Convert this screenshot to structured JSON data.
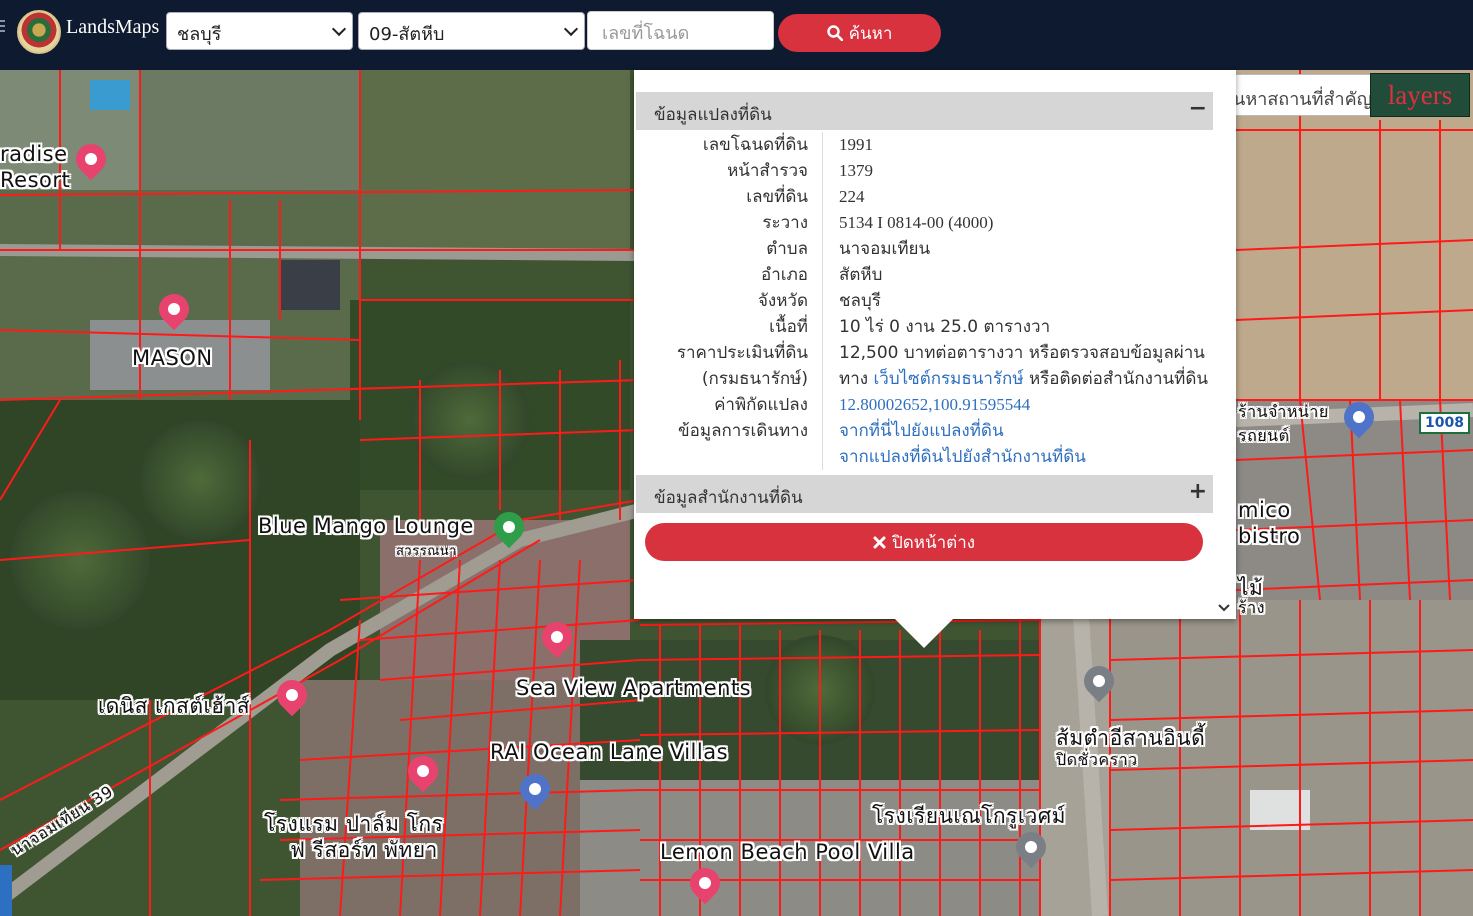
{
  "header": {
    "brand": "LandsMaps",
    "province_select": "ชลบุรี",
    "district_select": "09-สัตหีบ",
    "deed_placeholder": "เลขที่โฉนด",
    "search_label": "ค้นหา"
  },
  "place_search": {
    "placeholder": "ค้นหาสถานที่สำคัญ",
    "layers_label": "layers"
  },
  "popup": {
    "parcel_section_title": "ข้อมูลแปลงที่ดิน",
    "office_section_title": "ข้อมูลสำนักงานที่ดิน",
    "collapse_sign": "−",
    "expand_sign": "+",
    "rows": [
      {
        "label": "เลขโฉนดที่ดิน",
        "value": "1991"
      },
      {
        "label": "หน้าสำรวจ",
        "value": "1379"
      },
      {
        "label": "เลขที่ดิน",
        "value": "224"
      },
      {
        "label": "ระวาง",
        "value": "5134 I 0814-00 (4000)"
      },
      {
        "label": "ตำบล",
        "value": "นาจอมเทียน"
      },
      {
        "label": "อำเภอ",
        "value": "สัตหีบ"
      },
      {
        "label": "จังหวัด",
        "value": "ชลบุรี"
      },
      {
        "label": "เนื้อที่",
        "value": "10 ไร่ 0 งาน 25.0 ตารางวา"
      }
    ],
    "price": {
      "label_line1": "ราคาประเมินที่ดิน",
      "label_line2": "(กรมธนารักษ์)",
      "text_line1": "12,500 บาทต่อตารางวา หรือตรวจสอบข้อมูลผ่าน",
      "text_pre": "ทาง ",
      "link": "เว็บไซต์กรมธนารักษ์",
      "text_post": " หรือติดต่อสำนักงานที่ดิน"
    },
    "coords": {
      "label": "ค่าพิกัดแปลง",
      "value": "12.80002652,100.91595544"
    },
    "travel": {
      "label": "ข้อมูลการเดินทาง",
      "link1": "จากที่นี่ไปยังแปลงที่ดิน",
      "link2": "จากแปลงที่ดินไปยังสำนักงานที่ดิน"
    },
    "close_label": "ปิดหน้าต่าง"
  },
  "map_labels": {
    "paradise_1": "radise",
    "paradise_2": "Resort",
    "mason": "MASON",
    "blue_mango": "Blue Mango Lounge",
    "blue_mango_sub": "สวรรณนา",
    "sea_view": "Sea View Apartments",
    "denis": "เดนิส เกสต์เฮ้าส์",
    "rai_ocean": "RAI Ocean Lane Villas",
    "hotel_palm_1": "โรงแรม ปาล์ม โกร",
    "hotel_palm_2": "ฟ รีสอร์ท พัทยา",
    "lemon": "Lemon Beach Pool Villa",
    "school": "โรงเรียนเณโกรูเวศม์",
    "som_tam_1": "ส้มตำอีสานอินดี้",
    "som_tam_2": "ปิดชั่วคราว",
    "road_39": "นาจอมเทียน 39",
    "mico_1": "mico",
    "mico_2": "bistro",
    "car_shop_1": "ร้านจำหน่าย",
    "car_shop_2": "รถยนต์",
    "tree_1": "ไม้",
    "tree_2": "ร้าง",
    "road_1008": "1008"
  }
}
